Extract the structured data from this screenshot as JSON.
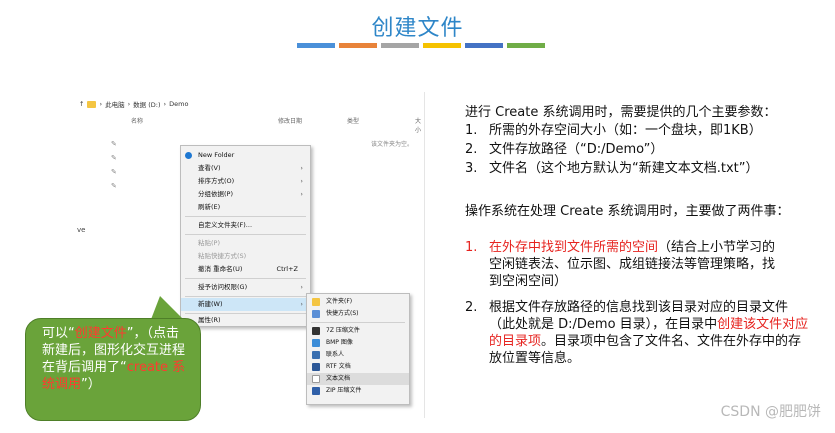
{
  "slide": {
    "title": "创建文件",
    "color_bars": [
      "#4a90d9",
      "#e8833a",
      "#a5a5a5",
      "#f5c200",
      "#4472c4",
      "#70ad47"
    ],
    "watermark": "CSDN @肥肥饼"
  },
  "explorer": {
    "breadcrumb": [
      "此电脑",
      "数据 (D:)",
      "Demo"
    ],
    "columns": [
      "名称",
      "修改日期",
      "类型",
      "大小"
    ],
    "empty_note": "该文件夹为空。",
    "left_fragments": [
      "ve"
    ],
    "context_menu": [
      {
        "label": "New Folder"
      },
      {
        "label": "查看(V)"
      },
      {
        "label": "排序方式(O)"
      },
      {
        "label": "分组依据(P)"
      },
      {
        "label": "刷新(E)"
      },
      {
        "label": "自定义文件夹(F)..."
      },
      {
        "label": "粘贴(P)"
      },
      {
        "label": "粘贴快捷方式(S)"
      },
      {
        "label": "撤消 重命名(U)",
        "shortcut": "Ctrl+Z"
      },
      {
        "label": "授予访问权限(G)"
      },
      {
        "label": "新建(W)"
      },
      {
        "label": "属性(R)"
      }
    ],
    "new_submenu": [
      {
        "label": "文件夹(F)",
        "color": "#f4c542"
      },
      {
        "label": "快捷方式(S)",
        "color": "#5b8fd6"
      },
      {
        "label": "7Z 压缩文件",
        "color": "#333333"
      },
      {
        "label": "BMP 图像",
        "color": "#3c8dd8"
      },
      {
        "label": "联系人",
        "color": "#3a6fb0"
      },
      {
        "label": "RTF 文档",
        "color": "#2b5797"
      },
      {
        "label": "文本文档",
        "color": "#9a9a9a"
      },
      {
        "label": "ZIP 压缩文件",
        "color": "#2f5fa8"
      }
    ]
  },
  "callout": {
    "p1": "可以“",
    "red1": "创建文件",
    "p2": "”，（点击新建后，图形化交互进程在背后调用了“",
    "red2": "create 系统调用",
    "p3": "”）"
  },
  "right": {
    "intro": "进行 Create 系统调用时，需要提供的几个主要参数：",
    "params": [
      {
        "num": "1.",
        "text": "所需的外存空间大小（如：一个盘块，即1KB）"
      },
      {
        "num": "2.",
        "text": "文件存放路径（“D:/Demo”）"
      },
      {
        "num": "3.",
        "text": "文件名（这个地方默认为“新建文本文档.txt”）"
      }
    ],
    "ops_intro": "操作系统在处理 Create 系统调用时，主要做了两件事：",
    "op1_num": "1.",
    "op1_red": "在外存中找到文件所需的空间",
    "op1_rest": "（结合上小节学习的空闲链表法、位示图、成组链接法等管理策略，找到空闲空间）",
    "op2_num": "2.",
    "op2_a": "根据文件存放路径的信息找到该目录对应的目录文件（此处就是 D:/Demo 目录），在目录中",
    "op2_red": "创建该文件对应的目录项",
    "op2_b": "。目录项中包含了文件名、文件在外存中的存放位置等信息。"
  }
}
